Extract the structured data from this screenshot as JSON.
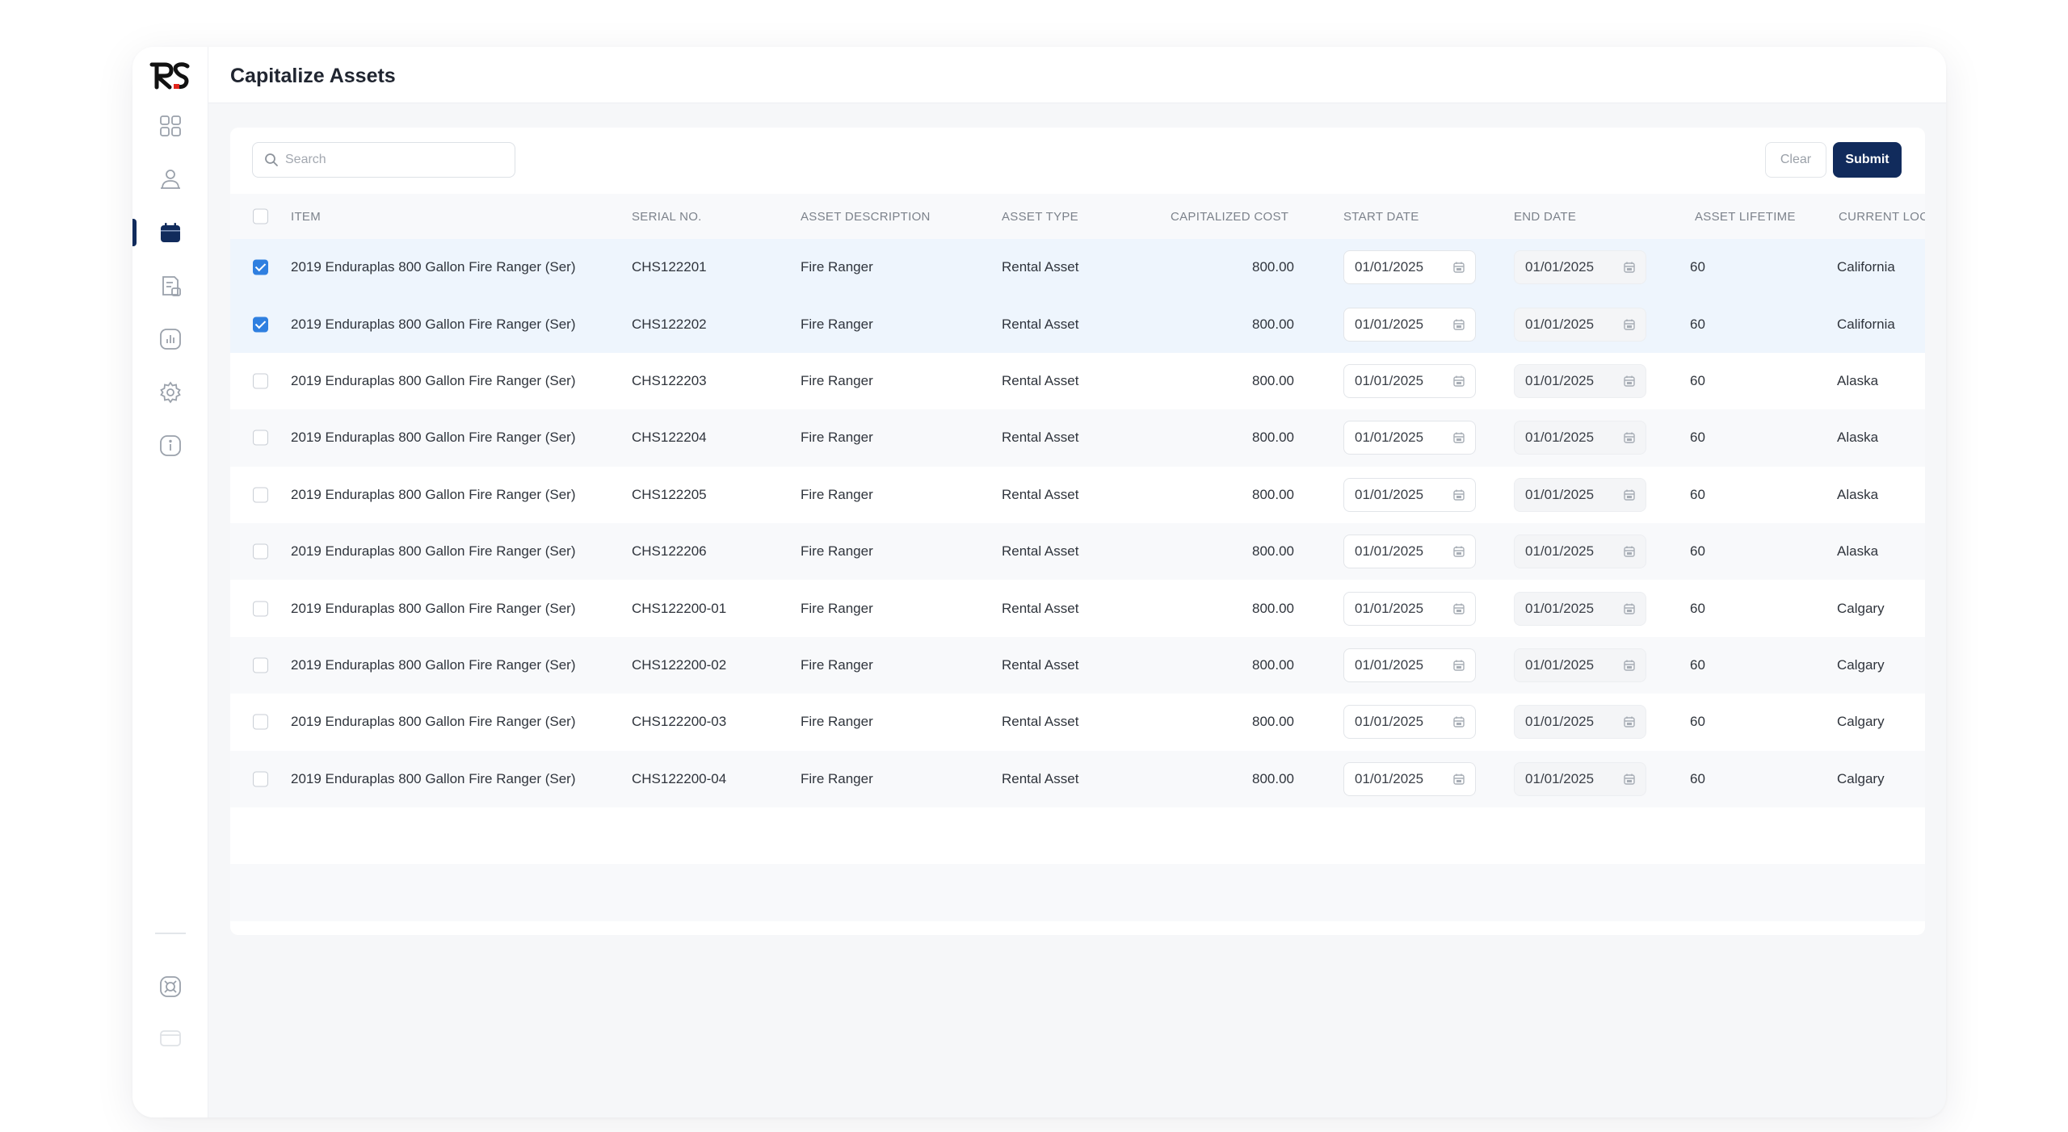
{
  "header": {
    "title": "Capitalize Assets"
  },
  "toolbar": {
    "search_placeholder": "Search",
    "clear_label": "Clear",
    "submit_label": "Submit"
  },
  "table": {
    "columns": {
      "item": "ITEM",
      "serial": "SERIAL NO.",
      "description": "ASSET DESCRIPTION",
      "type": "ASSET TYPE",
      "cost": "CAPITALIZED COST",
      "start": "START DATE",
      "end": "END DATE",
      "lifetime": "ASSET LIFETIME",
      "location": "CURRENT LOC"
    },
    "rows": [
      {
        "checked": true,
        "item": "2019 Enduraplas 800 Gallon Fire Ranger (Ser)",
        "serial": "CHS122201",
        "description": "Fire Ranger",
        "type": "Rental Asset",
        "cost": "800.00",
        "start": "01/01/2025",
        "end": "01/01/2025",
        "lifetime": "60",
        "location": "California"
      },
      {
        "checked": true,
        "item": "2019 Enduraplas 800 Gallon Fire Ranger (Ser)",
        "serial": "CHS122202",
        "description": "Fire Ranger",
        "type": "Rental Asset",
        "cost": "800.00",
        "start": "01/01/2025",
        "end": "01/01/2025",
        "lifetime": "60",
        "location": "California"
      },
      {
        "checked": false,
        "item": "2019 Enduraplas 800 Gallon Fire Ranger (Ser)",
        "serial": "CHS122203",
        "description": "Fire Ranger",
        "type": "Rental Asset",
        "cost": "800.00",
        "start": "01/01/2025",
        "end": "01/01/2025",
        "lifetime": "60",
        "location": "Alaska"
      },
      {
        "checked": false,
        "item": "2019 Enduraplas 800 Gallon Fire Ranger (Ser)",
        "serial": "CHS122204",
        "description": "Fire Ranger",
        "type": "Rental Asset",
        "cost": "800.00",
        "start": "01/01/2025",
        "end": "01/01/2025",
        "lifetime": "60",
        "location": "Alaska"
      },
      {
        "checked": false,
        "item": "2019 Enduraplas 800 Gallon Fire Ranger (Ser)",
        "serial": "CHS122205",
        "description": "Fire Ranger",
        "type": "Rental Asset",
        "cost": "800.00",
        "start": "01/01/2025",
        "end": "01/01/2025",
        "lifetime": "60",
        "location": "Alaska"
      },
      {
        "checked": false,
        "item": "2019 Enduraplas 800 Gallon Fire Ranger (Ser)",
        "serial": "CHS122206",
        "description": "Fire Ranger",
        "type": "Rental Asset",
        "cost": "800.00",
        "start": "01/01/2025",
        "end": "01/01/2025",
        "lifetime": "60",
        "location": "Alaska"
      },
      {
        "checked": false,
        "item": "2019 Enduraplas 800 Gallon Fire Ranger (Ser)",
        "serial": "CHS122200-01",
        "description": "Fire Ranger",
        "type": "Rental Asset",
        "cost": "800.00",
        "start": "01/01/2025",
        "end": "01/01/2025",
        "lifetime": "60",
        "location": "Calgary"
      },
      {
        "checked": false,
        "item": "2019 Enduraplas 800 Gallon Fire Ranger (Ser)",
        "serial": "CHS122200-02",
        "description": "Fire Ranger",
        "type": "Rental Asset",
        "cost": "800.00",
        "start": "01/01/2025",
        "end": "01/01/2025",
        "lifetime": "60",
        "location": "Calgary"
      },
      {
        "checked": false,
        "item": "2019 Enduraplas 800 Gallon Fire Ranger (Ser)",
        "serial": "CHS122200-03",
        "description": "Fire Ranger",
        "type": "Rental Asset",
        "cost": "800.00",
        "start": "01/01/2025",
        "end": "01/01/2025",
        "lifetime": "60",
        "location": "Calgary"
      },
      {
        "checked": false,
        "item": "2019 Enduraplas 800 Gallon Fire Ranger (Ser)",
        "serial": "CHS122200-04",
        "description": "Fire Ranger",
        "type": "Rental Asset",
        "cost": "800.00",
        "start": "01/01/2025",
        "end": "01/01/2025",
        "lifetime": "60",
        "location": "Calgary"
      }
    ]
  },
  "sidebar": {
    "items": [
      {
        "icon": "dashboard-grid-icon"
      },
      {
        "icon": "users-icon"
      },
      {
        "icon": "calendar-icon",
        "active": true
      },
      {
        "icon": "document-icon"
      },
      {
        "icon": "reports-chart-icon"
      },
      {
        "icon": "settings-gear-icon"
      },
      {
        "icon": "info-icon"
      }
    ],
    "bottom": [
      {
        "icon": "support-icon"
      },
      {
        "icon": "collapse-icon"
      }
    ]
  },
  "colors": {
    "brand": "#112b5c",
    "checkbox": "#2f7fe0",
    "logo_accent": "#e1251b"
  }
}
